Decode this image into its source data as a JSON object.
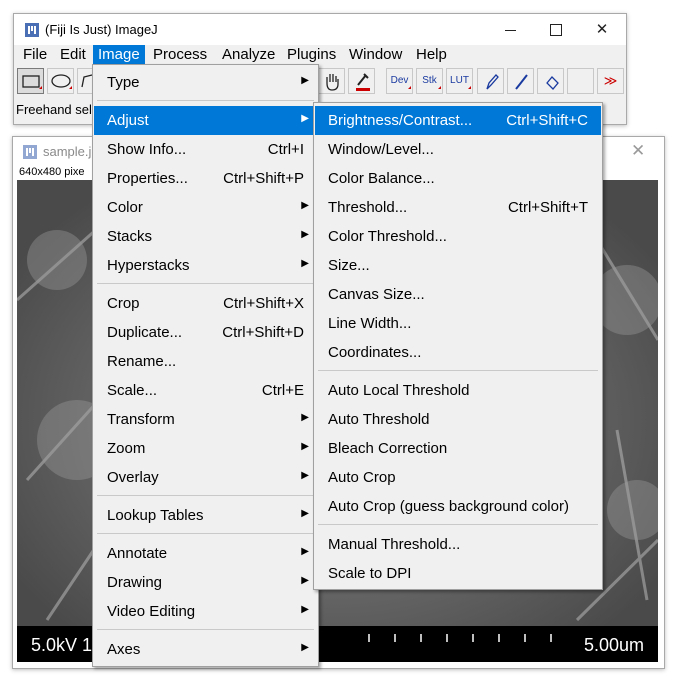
{
  "main_window": {
    "title": "(Fiji Is Just) ImageJ",
    "menubar": [
      "File",
      "Edit",
      "Image",
      "Process",
      "Analyze",
      "Plugins",
      "Window",
      "Help"
    ],
    "active_menu": "Image",
    "toolbar": {
      "dev_label": "Dev",
      "stk_label": "Stk",
      "lut_label": "LUT",
      "more_glyph": "≫"
    },
    "status": "Freehand sel"
  },
  "image_window": {
    "title": "sample.jp",
    "dims": "640x480 pixe",
    "sem_left": "5.0kV 1",
    "sem_right": "5.00um"
  },
  "image_menu": {
    "items": [
      {
        "label": "Type",
        "shortcut": "",
        "submenu": true
      },
      {
        "label": "Adjust",
        "shortcut": "",
        "submenu": true,
        "highlighted": true
      },
      {
        "label": "Show Info...",
        "shortcut": "Ctrl+I",
        "submenu": false
      },
      {
        "label": "Properties...",
        "shortcut": "Ctrl+Shift+P",
        "submenu": false
      },
      {
        "label": "Color",
        "shortcut": "",
        "submenu": true
      },
      {
        "label": "Stacks",
        "shortcut": "",
        "submenu": true
      },
      {
        "label": "Hyperstacks",
        "shortcut": "",
        "submenu": true
      },
      {
        "label": "Crop",
        "shortcut": "Ctrl+Shift+X",
        "submenu": false
      },
      {
        "label": "Duplicate...",
        "shortcut": "Ctrl+Shift+D",
        "submenu": false
      },
      {
        "label": "Rename...",
        "shortcut": "",
        "submenu": false
      },
      {
        "label": "Scale...",
        "shortcut": "Ctrl+E",
        "submenu": false
      },
      {
        "label": "Transform",
        "shortcut": "",
        "submenu": true
      },
      {
        "label": "Zoom",
        "shortcut": "",
        "submenu": true
      },
      {
        "label": "Overlay",
        "shortcut": "",
        "submenu": true
      },
      {
        "label": "Lookup Tables",
        "shortcut": "",
        "submenu": true
      },
      {
        "label": "Annotate",
        "shortcut": "",
        "submenu": true
      },
      {
        "label": "Drawing",
        "shortcut": "",
        "submenu": true
      },
      {
        "label": "Video Editing",
        "shortcut": "",
        "submenu": true
      },
      {
        "label": "Axes",
        "shortcut": "",
        "submenu": true
      }
    ]
  },
  "adjust_menu": {
    "items": [
      {
        "label": "Brightness/Contrast...",
        "shortcut": "Ctrl+Shift+C",
        "highlighted": true
      },
      {
        "label": "Window/Level...",
        "shortcut": ""
      },
      {
        "label": "Color Balance...",
        "shortcut": ""
      },
      {
        "label": "Threshold...",
        "shortcut": "Ctrl+Shift+T"
      },
      {
        "label": "Color Threshold...",
        "shortcut": ""
      },
      {
        "label": "Size...",
        "shortcut": ""
      },
      {
        "label": "Canvas Size...",
        "shortcut": ""
      },
      {
        "label": "Line Width...",
        "shortcut": ""
      },
      {
        "label": "Coordinates...",
        "shortcut": ""
      },
      {
        "label": "Auto Local Threshold",
        "shortcut": ""
      },
      {
        "label": "Auto Threshold",
        "shortcut": ""
      },
      {
        "label": "Bleach Correction",
        "shortcut": ""
      },
      {
        "label": "Auto Crop",
        "shortcut": ""
      },
      {
        "label": "Auto Crop (guess background color)",
        "shortcut": ""
      },
      {
        "label": "Manual Threshold...",
        "shortcut": ""
      },
      {
        "label": "Scale to DPI",
        "shortcut": ""
      }
    ]
  },
  "colors": {
    "highlight": "#0078d7",
    "menu_bg": "#f0f0f0",
    "separator": "#c9c9c9"
  }
}
